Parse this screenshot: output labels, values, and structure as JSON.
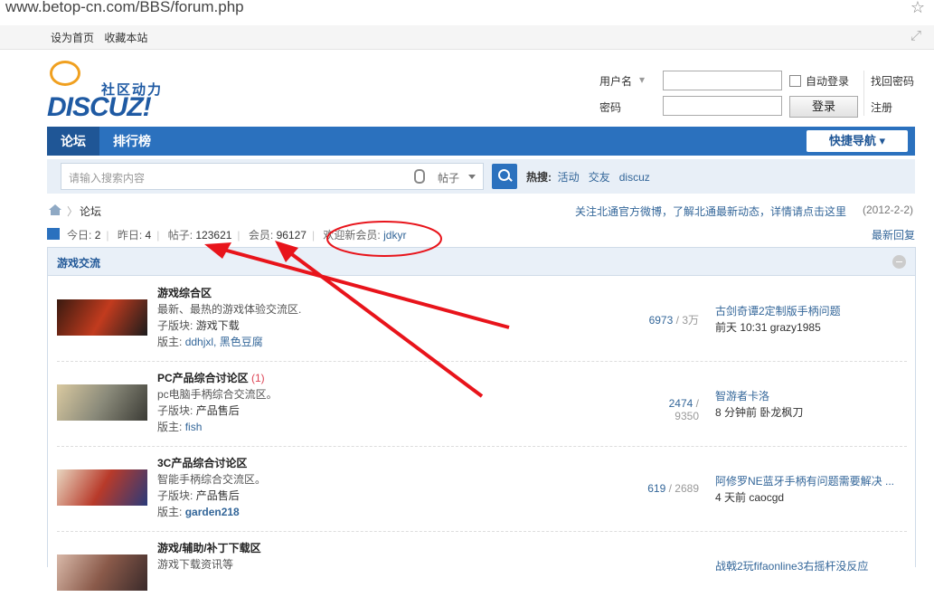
{
  "address_bar": {
    "url": "www.betop-cn.com/BBS/forum.php"
  },
  "top_links": [
    "设为首页",
    "收藏本站"
  ],
  "logo": {
    "slogan": "社区动力",
    "word": "DISCUZ!"
  },
  "login": {
    "username_label": "用户名",
    "password_label": "密码",
    "auto_login": "自动登录",
    "login_button": "登录",
    "find_password": "找回密码",
    "register": "注册"
  },
  "nav": {
    "tabs": [
      "论坛",
      "排行榜"
    ],
    "quick_nav": "快捷导航"
  },
  "search": {
    "placeholder": "请输入搜索内容",
    "type": "帖子",
    "hot_label": "热搜:",
    "hot_terms": [
      "活动",
      "交友",
      "discuz"
    ]
  },
  "breadcrumb": {
    "current": "论坛",
    "notice": "关注北通官方微博，了解北通最新动态，详情请点击这里",
    "date": "(2012-2-2)"
  },
  "stats": {
    "today_label": "今日:",
    "today": "2",
    "yesterday_label": "昨日:",
    "yesterday": "4",
    "posts_label": "帖子:",
    "posts": "123621",
    "members_label": "会员:",
    "members": "96127",
    "new_member_label": "欢迎新会员:",
    "new_member": "jdkyr",
    "latest_replies": "最新回复"
  },
  "section": {
    "title": "游戏交流"
  },
  "forums": [
    {
      "name": "游戏综合区",
      "new_count": "",
      "desc": "最新、最热的游戏体验交流区.",
      "sub_label": "子版块:",
      "sub": "游戏下载",
      "mod_label": "版主:",
      "mods": "ddhjxl, 黑色豆腐",
      "threads": "6973",
      "posts": "3万",
      "last_title": "古剑奇谭2定制版手柄问题",
      "last_info": "前天 10:31 grazy1985",
      "thumb_colors": [
        "#3a1a10",
        "#c23b1e",
        "#1c1c1c"
      ]
    },
    {
      "name": "PC产品综合讨论区",
      "new_count": "(1)",
      "desc": "pc电脑手柄综合交流区。",
      "sub_label": "子版块:",
      "sub": "产品售后",
      "mod_label": "版主:",
      "mods": "fish",
      "threads": "2474",
      "posts": "9350",
      "last_title": "智游者卡洛",
      "last_info": "8 分钟前 卧龙枫刀",
      "thumb_colors": [
        "#d9c9a0",
        "#8a8a7a",
        "#3b3b35"
      ]
    },
    {
      "name": "3C产品综合讨论区",
      "new_count": "",
      "desc": "智能手柄综合交流区。",
      "sub_label": "子版块:",
      "sub": "产品售后",
      "mod_label": "版主:",
      "mods": "garden218",
      "threads": "619",
      "posts": "2689",
      "last_title": "阿修罗NE蓝牙手柄有问题需要解决 ...",
      "last_info": "4 天前 caocgd",
      "thumb_colors": [
        "#e8d6c0",
        "#b83a2a",
        "#2a3a7a"
      ]
    },
    {
      "name": "游戏/辅助/补丁下载区",
      "new_count": "",
      "desc": "游戏下载资讯等",
      "sub_label": "",
      "sub": "",
      "mod_label": "",
      "mods": "",
      "threads": "",
      "posts": "",
      "last_title": "战戟2玩fifaonline3右摇杆没反应",
      "last_info": "",
      "thumb_colors": [
        "#d8b8a8",
        "#8a5a4a",
        "#3a2a2a"
      ]
    }
  ],
  "annotation_color": "#e8141b"
}
